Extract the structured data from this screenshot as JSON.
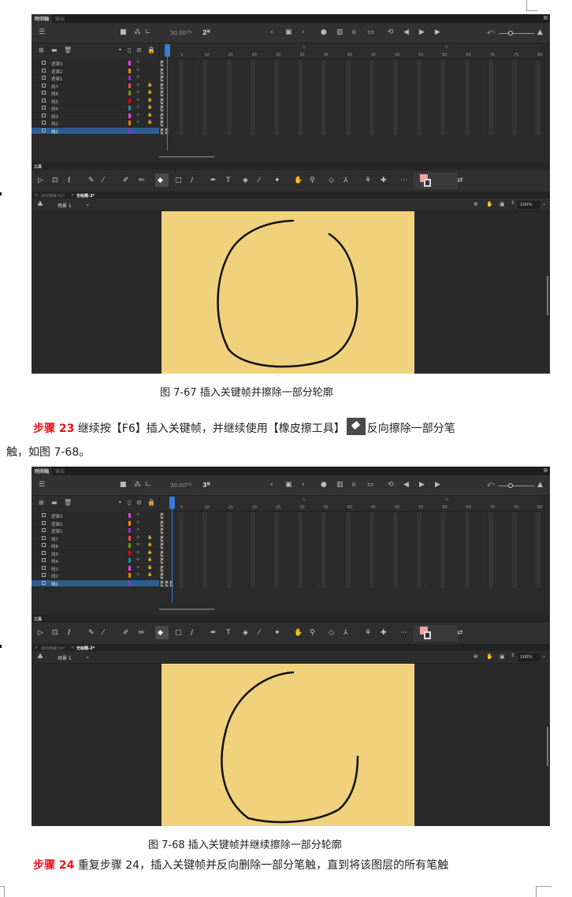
{
  "shots": [
    {
      "panel_tabs": [
        "时间轴",
        "输出"
      ],
      "fps": "30.00",
      "fps_unit": "FPS",
      "frame": "2",
      "frame_unit": "帧",
      "ruler_labels": [
        "5",
        "10",
        "15",
        "20",
        "25",
        "30",
        "35",
        "40",
        "45",
        "50",
        "55",
        "60",
        "65",
        "70",
        "75",
        "80"
      ],
      "ruler_seconds": [
        "1s",
        "2s"
      ],
      "current_frame": 2,
      "layers": [
        {
          "name": "遮罩3",
          "color": "#e83de0",
          "locked": false
        },
        {
          "name": "遮罩2",
          "color": "#f08a00",
          "locked": false
        },
        {
          "name": "遮罩1",
          "color": "#9a30c8",
          "locked": false
        },
        {
          "name": "线7",
          "color": "#f04c4c",
          "locked": true
        },
        {
          "name": "线6",
          "color": "#6a9a10",
          "locked": true
        },
        {
          "name": "线5",
          "color": "#e80000",
          "locked": true
        },
        {
          "name": "线4",
          "color": "#0a9a9a",
          "locked": true
        },
        {
          "name": "线3",
          "color": "#f040e0",
          "locked": true
        },
        {
          "name": "线2",
          "color": "#f08000",
          "locked": true
        },
        {
          "name": "线1",
          "color": "#9030c0",
          "locked": false,
          "selected": true
        }
      ],
      "tools_label": "工具",
      "doc_tabs": [
        "游戏精编.fla*",
        "无标题-2*"
      ],
      "scene": "场景 1",
      "zoom": "100%",
      "stage_color": "#f0d17c"
    },
    {
      "panel_tabs": [
        "时间轴",
        "输出"
      ],
      "fps": "30.00",
      "fps_unit": "FPS",
      "frame": "3",
      "frame_unit": "帧",
      "ruler_labels": [
        "5",
        "10",
        "15",
        "20",
        "25",
        "30",
        "35",
        "40",
        "45",
        "50",
        "55",
        "60",
        "65",
        "70",
        "75",
        "80"
      ],
      "ruler_seconds": [
        "1s",
        "2s"
      ],
      "current_frame": 3,
      "layers": [
        {
          "name": "遮罩3",
          "color": "#e83de0",
          "locked": false
        },
        {
          "name": "遮罩2",
          "color": "#f08a00",
          "locked": false
        },
        {
          "name": "遮罩1",
          "color": "#9a30c8",
          "locked": false
        },
        {
          "name": "线7",
          "color": "#f04c4c",
          "locked": true
        },
        {
          "name": "线6",
          "color": "#6a9a10",
          "locked": true
        },
        {
          "name": "线5",
          "color": "#e80000",
          "locked": true
        },
        {
          "name": "线4",
          "color": "#0a9a9a",
          "locked": true
        },
        {
          "name": "线3",
          "color": "#f040e0",
          "locked": true
        },
        {
          "name": "线2",
          "color": "#f08000",
          "locked": true
        },
        {
          "name": "线1",
          "color": "#9030c0",
          "locked": false,
          "selected": true
        }
      ],
      "tools_label": "工具",
      "doc_tabs": [
        "游戏精编.fla*",
        "无标题-2*"
      ],
      "scene": "场景 1",
      "zoom": "100%",
      "stage_color": "#f0d17c"
    }
  ],
  "caption1": "图 7-67  插入关键帧并擦除一部分轮廓",
  "step23": {
    "label": "步骤 23",
    "text1": " 继续按【F6】插入关键帧，并继续使用【橡皮擦工具】",
    "text2": "反向擦除一部分笔",
    "text3": "触，如图 7-68。"
  },
  "caption2": "图 7-68  插入关键帧并继续擦除一部分轮廓",
  "step24": {
    "label": "步骤 24",
    "text": " 重复步骤 24，插入关键帧并反向删除一部分笔触，直到将该图层的所有笔触"
  }
}
